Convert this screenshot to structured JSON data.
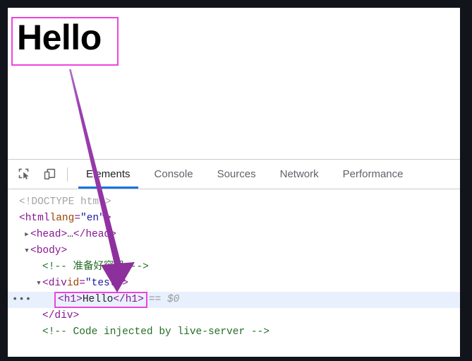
{
  "page": {
    "heading_text": "Hello",
    "highlight_color": "#ee44dd"
  },
  "devtools": {
    "toolbar": {
      "inspect_icon": "inspect-element-icon",
      "device_toolbar_icon": "device-toolbar-icon"
    },
    "tabs": [
      {
        "label": "Elements",
        "active": true
      },
      {
        "label": "Console",
        "active": false
      },
      {
        "label": "Sources",
        "active": false
      },
      {
        "label": "Network",
        "active": false
      },
      {
        "label": "Performance",
        "active": false
      }
    ],
    "active_tab_underline_color": "#1a73e8",
    "dom_tree": {
      "rows": [
        {
          "id": "doctype",
          "twisty": "",
          "indent": 1,
          "selected": false,
          "badge": "",
          "tokens": [
            {
              "t": "<!DOCTYPE html>",
              "c": "tok-doctype"
            }
          ]
        },
        {
          "id": "html-open",
          "twisty": "",
          "indent": 1,
          "selected": false,
          "badge": "",
          "tokens": [
            {
              "t": "<html",
              "c": "tok-tag"
            },
            {
              "t": " lang",
              "c": "tok-attr"
            },
            {
              "t": "=",
              "c": "tok-tag"
            },
            {
              "t": "\"en\"",
              "c": "tok-value"
            },
            {
              "t": ">",
              "c": "tok-tag"
            }
          ]
        },
        {
          "id": "head",
          "twisty": "▶",
          "indent": 2,
          "selected": false,
          "badge": "",
          "tokens": [
            {
              "t": "<head>",
              "c": "tok-tag"
            },
            {
              "t": "…",
              "c": "tok-text"
            },
            {
              "t": "</head>",
              "c": "tok-tag"
            }
          ]
        },
        {
          "id": "body-open",
          "twisty": "▼",
          "indent": 2,
          "selected": false,
          "badge": "",
          "tokens": [
            {
              "t": "<body>",
              "c": "tok-tag"
            }
          ]
        },
        {
          "id": "comment-container",
          "twisty": "",
          "indent": 3,
          "selected": false,
          "badge": "",
          "tokens": [
            {
              "t": "<!-- 准备好容器 -->",
              "c": "tok-comment"
            }
          ]
        },
        {
          "id": "div-test-open",
          "twisty": "▼",
          "indent": 3,
          "selected": false,
          "badge": "",
          "tokens": [
            {
              "t": "<div",
              "c": "tok-tag"
            },
            {
              "t": " id",
              "c": "tok-attr"
            },
            {
              "t": "=",
              "c": "tok-tag"
            },
            {
              "t": "\"test\"",
              "c": "tok-value"
            },
            {
              "t": ">",
              "c": "tok-tag"
            }
          ]
        },
        {
          "id": "h1-selected",
          "twisty": "",
          "indent": 4,
          "selected": true,
          "badge": "•••",
          "boxed": true,
          "boxed_tokens": [
            {
              "t": "<h1>",
              "c": "tok-tag"
            },
            {
              "t": "Hello",
              "c": "tok-text"
            },
            {
              "t": "</h1>",
              "c": "tok-tag"
            }
          ],
          "tokens": [
            {
              "t": " == $0",
              "c": "tok-ref"
            }
          ]
        },
        {
          "id": "div-test-close",
          "twisty": "",
          "indent": 3,
          "selected": false,
          "badge": "",
          "tokens": [
            {
              "t": "</div>",
              "c": "tok-tag"
            }
          ]
        },
        {
          "id": "comment-live-server",
          "twisty": "",
          "indent": 3,
          "selected": false,
          "badge": "",
          "tokens": [
            {
              "t": "<!-- Code injected by live-server -->",
              "c": "tok-comment"
            }
          ]
        }
      ]
    }
  },
  "annotation": {
    "arrow_color": "#8e2f9e",
    "arrow_name": "pointer-arrow-annotation"
  }
}
